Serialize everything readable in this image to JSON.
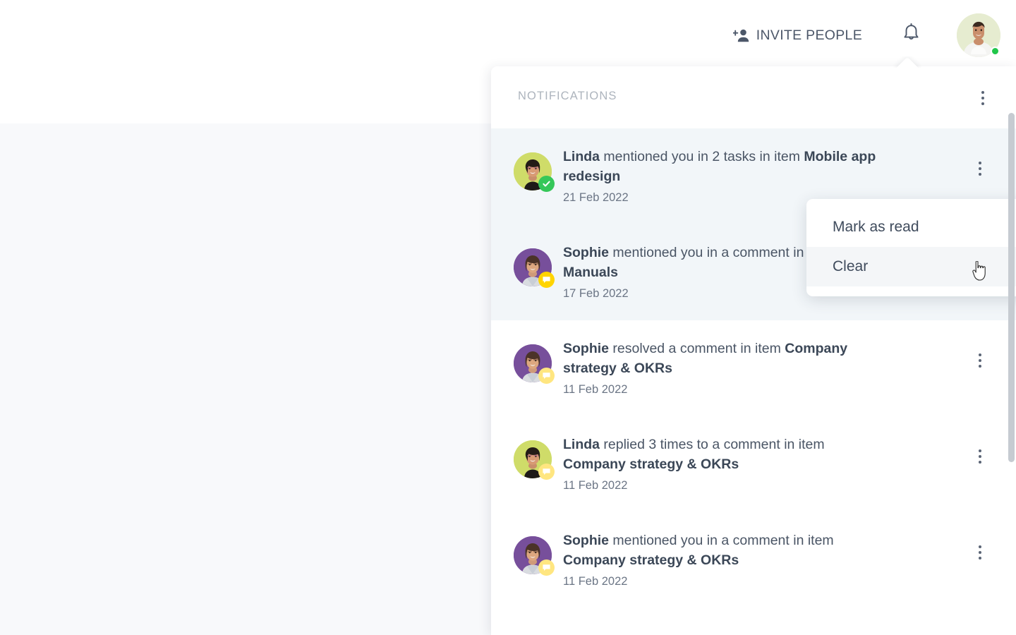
{
  "topbar": {
    "invite_label": "INVITE PEOPLE",
    "invite_icon": "add-person-icon",
    "bell_icon": "bell-icon",
    "avatar_icon": "user-avatar",
    "online_status": "online"
  },
  "notifications_panel": {
    "title": "NOTIFICATIONS",
    "header_menu_icon": "kebab-menu-icon",
    "items": [
      {
        "actor": "Linda",
        "text_before": " mentioned you in 2 tasks in item ",
        "target": "Mobile app redesign",
        "date": "21 Feb 2022",
        "read": false,
        "avatar_color": "#cfdc69",
        "badge": "check",
        "badge_color": "#35c759",
        "menu_icon": "kebab-menu-icon"
      },
      {
        "actor": "Sophie",
        "text_before": " mentioned you in a comment in item ",
        "target": "Manuals",
        "date": "17 Feb 2022",
        "read": false,
        "avatar_color": "#774f9b",
        "badge": "comment",
        "badge_color": "#ffd400",
        "menu_icon": "kebab-menu-icon"
      },
      {
        "actor": "Sophie",
        "text_before": " resolved a comment in item ",
        "target": "Company strategy & OKRs",
        "date": "11 Feb 2022",
        "read": true,
        "avatar_color": "#774f9b",
        "badge": "comment",
        "badge_color": "#ffe680",
        "menu_icon": "kebab-menu-icon"
      },
      {
        "actor": "Linda",
        "text_before": " replied 3 times to a comment in item ",
        "target": "Company strategy & OKRs",
        "date": "11 Feb 2022",
        "read": true,
        "avatar_color": "#cfdc69",
        "badge": "comment",
        "badge_color": "#ffe680",
        "menu_icon": "kebab-menu-icon"
      },
      {
        "actor": "Sophie",
        "text_before": " mentioned you in a comment in item ",
        "target": "Company strategy & OKRs",
        "date": "11 Feb 2022",
        "read": true,
        "avatar_color": "#774f9b",
        "badge": "comment",
        "badge_color": "#ffe680",
        "menu_icon": "kebab-menu-icon"
      }
    ]
  },
  "context_menu": {
    "items": [
      {
        "label": "Mark as read",
        "hovered": false
      },
      {
        "label": "Clear",
        "hovered": true
      }
    ]
  },
  "colors": {
    "page_background": "#f8f9fb",
    "panel_background": "#ffffff",
    "unread_row": "#f2f6f9",
    "text_primary": "#3b4757",
    "text_secondary": "#4a5565",
    "text_muted": "#adb4bd",
    "accent_green": "#35c759",
    "accent_yellow": "#ffd400",
    "avatar_olive": "#cfdc69",
    "avatar_purple": "#774f9b",
    "scrollbar": "#c6cbd1"
  }
}
